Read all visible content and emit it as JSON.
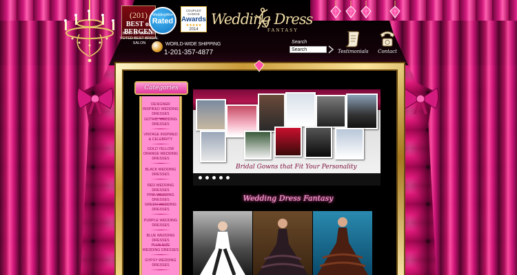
{
  "header": {
    "badges": {
      "best_number": "(201)",
      "best_name": "BEST of BERGEN",
      "best_caption_line1": "BEST OF BERGEN",
      "best_caption_line2": "VOTED BEST BRIDAL",
      "best_caption_line3": "SALON",
      "rated_small": "WeddingWire",
      "rated_big": "Rated",
      "awards_top": "COUPLES' CHOICE",
      "awards_mid": "Awards",
      "awards_stars": "★★★★★",
      "awards_year": "2014"
    },
    "shipping_label": "WORLD-WIDE SHIPPING",
    "phone": "1-201-357-4877",
    "logo": {
      "line1": "Wedding Dress",
      "line2": "FANTASY"
    },
    "search": {
      "label": "Search",
      "value": "Search"
    },
    "nav": [
      {
        "label": "Testimonials",
        "icon": "scroll-icon"
      },
      {
        "label": "Contact",
        "icon": "telephone-icon"
      }
    ],
    "gems_count": 4
  },
  "sidebar": {
    "title": "Categories",
    "items": [
      {
        "label": "DESIGNER INSPIRED WEDDING DRESSES"
      },
      {
        "label": "GOTHIC WEDDING DRESSES"
      },
      {
        "label": "VINTAGE INSPIRED & CELEBRITY"
      },
      {
        "label": "GOLD YELLOW ORANGE WEDDING DRESSES"
      },
      {
        "label": "BLACK WEDDING DRESSES"
      },
      {
        "label": "RED WEDDING DRESSES"
      },
      {
        "label": "PINK WEDDING DRESSES"
      },
      {
        "label": "GREEN WEDDING DRESSES"
      },
      {
        "label": "PURPLE WEDDING DRESSES"
      },
      {
        "label": "BLUE WEDDING DRESSES"
      },
      {
        "label": "PLUS SIZE WEDDING DRESSES"
      },
      {
        "label": "GYPSY WEDDING DRESSES"
      }
    ]
  },
  "slideshow": {
    "caption": "Bridal Gowns that Fit Your Personality",
    "slide_count": 5,
    "active_slide": 1
  },
  "section": {
    "title": "Wedding Dress Fantasy"
  },
  "colors": {
    "brand_pink": "#e21d85",
    "gold": "#d9b560",
    "sidebar_bg": "#ff8fd0",
    "sidebar_text": "#8a0a4a"
  }
}
